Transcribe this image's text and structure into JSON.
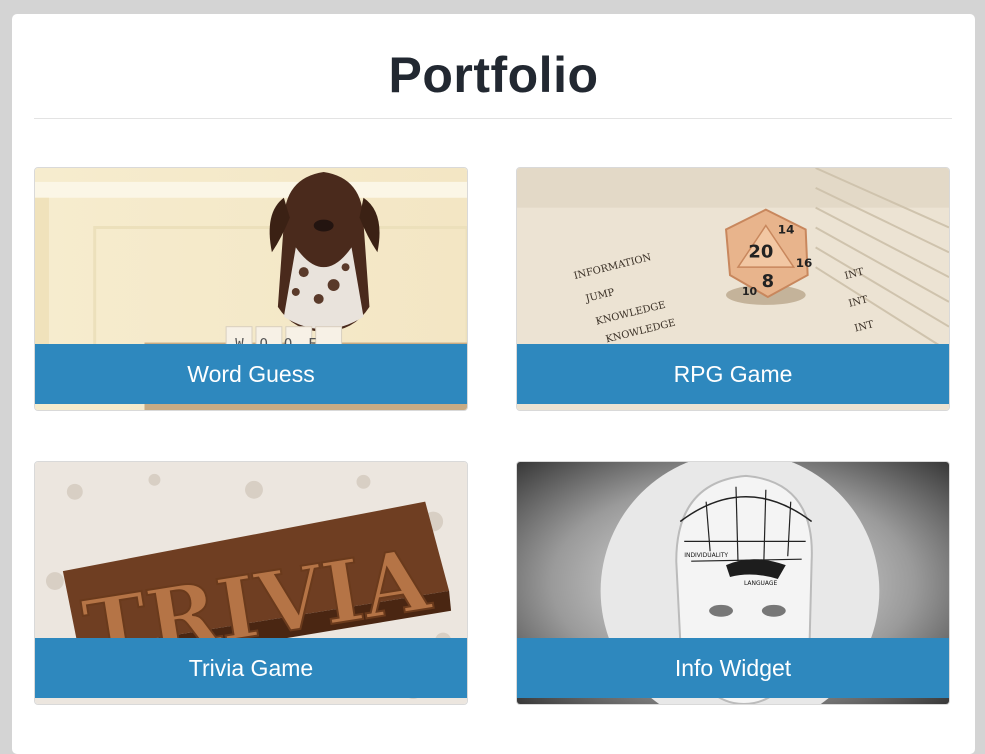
{
  "header": {
    "title": "Portfolio"
  },
  "projects": [
    {
      "label": "Word Guess",
      "image_text": "WOOF"
    },
    {
      "label": "RPG Game",
      "image_text": [
        "20",
        "14",
        "8",
        "16",
        "10",
        "INT",
        "INFORMATION",
        "JUMP",
        "KNOWLEDGE"
      ]
    },
    {
      "label": "Trivia Game",
      "image_text": "TRIVIA"
    },
    {
      "label": "Info Widget",
      "image_text": [
        "INDIVIDUALITY",
        "LANGUAGE"
      ]
    }
  ],
  "colors": {
    "page_background": "#d4d4d4",
    "panel": "#ffffff",
    "label_bar": "#2e88be",
    "title_text": "#222831"
  }
}
